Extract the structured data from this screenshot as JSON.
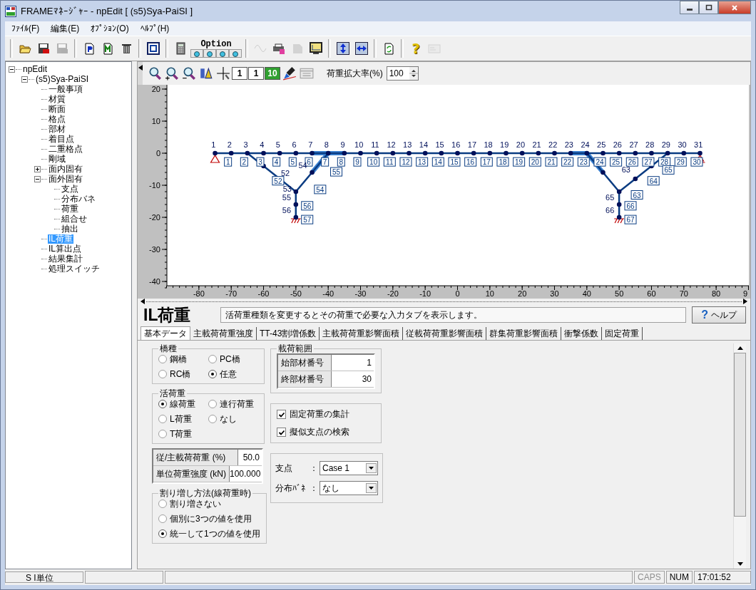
{
  "window": {
    "title": "FRAMEﾏﾈｰｼﾞｬｰ - npEdit [ (s5)Sya-PaiSI ]"
  },
  "menu": [
    {
      "label": "ﾌｧｲﾙ(F)"
    },
    {
      "label": "編集(E)"
    },
    {
      "label": "ｵﾌﾟｼｮﾝ(O)"
    },
    {
      "label": "ﾍﾙﾌﾟ(H)"
    }
  ],
  "toolbar": [
    [
      {
        "kind": "open",
        "disabled": false
      },
      {
        "kind": "save",
        "disabled": false
      },
      {
        "kind": "save",
        "disabled": true
      }
    ],
    [
      {
        "kind": "doc-p",
        "disabled": false
      },
      {
        "kind": "doc-m",
        "disabled": false
      },
      {
        "kind": "trash",
        "disabled": false
      }
    ],
    [
      {
        "kind": "grid",
        "disabled": false
      }
    ],
    [
      {
        "kind": "calc",
        "disabled": false
      },
      {
        "kind": "option",
        "label": "Option",
        "disabled": false
      }
    ],
    [
      {
        "kind": "wave",
        "disabled": true
      },
      {
        "kind": "print",
        "disabled": false
      },
      {
        "kind": "page",
        "disabled": true
      },
      {
        "kind": "monitor",
        "disabled": false
      }
    ],
    [
      {
        "kind": "vsplit",
        "disabled": false
      },
      {
        "kind": "hsplit",
        "disabled": false
      }
    ],
    [
      {
        "kind": "refresh",
        "disabled": false
      }
    ],
    [
      {
        "kind": "help",
        "glyph": "?",
        "disabled": false
      },
      {
        "kind": "card",
        "disabled": true
      }
    ]
  ],
  "tree": [
    {
      "label": "npEdit",
      "expanded": true,
      "selected": false,
      "children": [
        {
          "label": "(s5)Sya-PaiSI",
          "expanded": true,
          "selected": false,
          "children": [
            {
              "label": "一般事項",
              "selected": false
            },
            {
              "label": "材質",
              "selected": false
            },
            {
              "label": "断面",
              "selected": false
            },
            {
              "label": "格点",
              "selected": false
            },
            {
              "label": "部材",
              "selected": false
            },
            {
              "label": "着目点",
              "selected": false
            },
            {
              "label": "二重格点",
              "selected": false
            },
            {
              "label": "剛域",
              "selected": false
            },
            {
              "label": "面内固有",
              "expanded": false,
              "selected": false
            },
            {
              "label": "面外固有",
              "expanded": true,
              "selected": false,
              "children": [
                {
                  "label": "支点",
                  "selected": false
                },
                {
                  "label": "分布バネ",
                  "selected": false
                },
                {
                  "label": "荷重",
                  "selected": false
                },
                {
                  "label": "組合せ",
                  "selected": false
                },
                {
                  "label": "抽出",
                  "selected": false
                }
              ]
            },
            {
              "label": "IL荷重",
              "selected": true
            },
            {
              "label": "IL算出点",
              "selected": false
            },
            {
              "label": "結果集計",
              "selected": false
            },
            {
              "label": "処理スイッチ",
              "selected": false
            }
          ]
        }
      ]
    }
  ],
  "view_toolbar": {
    "tools": [
      {
        "kind": "zoom"
      },
      {
        "kind": "zoom-in"
      },
      {
        "kind": "zoom-out"
      },
      {
        "kind": "chart"
      },
      {
        "kind": "cross"
      },
      {
        "kind": "node-number",
        "glyph": "1"
      },
      {
        "kind": "member-number",
        "glyph": "1"
      },
      {
        "kind": "support",
        "glyph": "10"
      },
      {
        "kind": "brush"
      },
      {
        "kind": "window"
      }
    ],
    "scale_label": "荷重拡大率(%)",
    "scale_value": "100"
  },
  "frame_view": {
    "y_axis_labels": [
      "20",
      "10",
      "0",
      "-10",
      "-20",
      "-30",
      "-40"
    ],
    "x_axis_labels": [
      "-80",
      "-70",
      "-60",
      "-50",
      "-40",
      "-30",
      "-20",
      "-10",
      "0",
      "10",
      "20",
      "30",
      "40",
      "50",
      "60",
      "70",
      "80",
      "9"
    ],
    "node_labels": [
      "1",
      "2",
      "3",
      "4",
      "5",
      "6",
      "7",
      "8",
      "9",
      "10",
      "11",
      "12",
      "13",
      "14",
      "15",
      "16",
      "17",
      "18",
      "19",
      "20",
      "21",
      "22",
      "23",
      "24",
      "25",
      "26",
      "27",
      "28",
      "29",
      "30",
      "31",
      "52",
      "53",
      "54",
      "55",
      "56",
      "63",
      "65",
      "66"
    ],
    "member_labels": [
      "1",
      "2",
      "3",
      "4",
      "5",
      "6",
      "7",
      "8",
      "9",
      "10",
      "11",
      "12",
      "13",
      "14",
      "15",
      "16",
      "17",
      "18",
      "19",
      "20",
      "21",
      "22",
      "23",
      "24",
      "25",
      "26",
      "27",
      "28",
      "29",
      "30",
      "52",
      "54",
      "55",
      "56",
      "57",
      "63",
      "64",
      "65",
      "66",
      "67"
    ]
  },
  "panel": {
    "title": "IL荷重",
    "description": "活荷重種類を変更するとその荷重で必要な入力タブを表示します。",
    "help_button": {
      "icon": "?",
      "label": "ヘルプ"
    },
    "tabs": [
      {
        "label": "基本データ",
        "selected": true
      },
      {
        "label": "主載荷荷重強度",
        "selected": false
      },
      {
        "label": "TT-43割増係数",
        "selected": false
      },
      {
        "label": "主載荷荷重影響面積",
        "selected": false
      },
      {
        "label": "従載荷荷重影響面積",
        "selected": false
      },
      {
        "label": "群集荷重影響面積",
        "selected": false
      },
      {
        "label": "衝撃係数",
        "selected": false
      },
      {
        "label": "固定荷重",
        "selected": false
      }
    ],
    "bridge_type": {
      "legend": "橋種",
      "options": [
        {
          "label": "鋼橋",
          "selected": false
        },
        {
          "label": "PC橋",
          "selected": false
        },
        {
          "label": "RC橋",
          "selected": false
        },
        {
          "label": "任意",
          "selected": true
        }
      ]
    },
    "live_load": {
      "legend": "活荷重",
      "options": [
        {
          "label": "線荷重",
          "selected": true
        },
        {
          "label": "連行荷重",
          "selected": false
        },
        {
          "label": "L荷重",
          "selected": false
        },
        {
          "label": "なし",
          "selected": false
        },
        {
          "label": "T荷重",
          "selected": false
        }
      ]
    },
    "load_values": [
      {
        "label": "従/主載荷荷重 (%)",
        "value": "50.0"
      },
      {
        "label": "単位荷重強度 (kN)",
        "value": "100.000"
      }
    ],
    "increase_method": {
      "legend": "割り増し方法(線荷重時)",
      "options": [
        {
          "label": "割り増さない",
          "selected": false
        },
        {
          "label": "個別に3つの値を使用",
          "selected": false
        },
        {
          "label": "統一して1つの値を使用",
          "selected": true
        }
      ]
    },
    "load_range": {
      "legend": "載荷範囲",
      "rows": [
        {
          "label": "始部材番号",
          "value": "1"
        },
        {
          "label": "終部材番号",
          "value": "30"
        }
      ]
    },
    "options": [
      {
        "label": "固定荷重の集計",
        "checked": true
      },
      {
        "label": "擬似支点の検索",
        "checked": true
      }
    ],
    "selects": [
      {
        "label": "支点",
        "separator": "：",
        "value": "Case 1"
      },
      {
        "label": "分布ﾊﾞﾈ",
        "separator": "：",
        "value": "なし"
      }
    ]
  },
  "status_bar": {
    "unit": "S I単位",
    "indicators": [
      {
        "text": "CAPS",
        "on": false
      },
      {
        "text": "NUM",
        "on": true
      }
    ],
    "time": "17:01:52"
  }
}
